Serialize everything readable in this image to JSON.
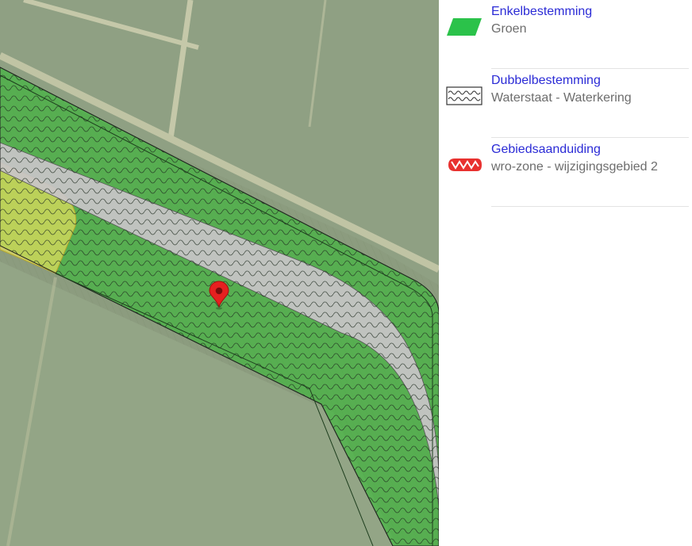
{
  "map": {
    "marker_icon": "map-pin-icon",
    "colors": {
      "enkelbestemming_groen": "#2bbd2b",
      "gebiedsaanduiding": "#e8e06a",
      "road": "#c9c4c9",
      "marker": "#e62020"
    }
  },
  "legend": {
    "items": [
      {
        "title": "Enkelbestemming",
        "subtitle": "Groen",
        "swatch_icon": "green-parallelogram-icon",
        "swatch_color": "#2bc24a"
      },
      {
        "title": "Dubbelbestemming",
        "subtitle": "Waterstaat - Waterkering",
        "swatch_icon": "wave-pattern-icon",
        "swatch_color": "#333333"
      },
      {
        "title": "Gebiedsaanduiding",
        "subtitle": "wro-zone - wijzigingsgebied 2",
        "swatch_icon": "red-zigzag-icon",
        "swatch_color": "#e8312f"
      }
    ]
  }
}
